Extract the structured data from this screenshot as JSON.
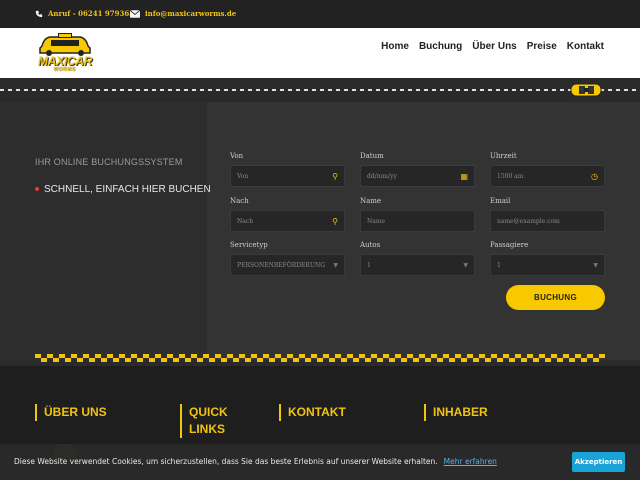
{
  "topbar": {
    "phone": "Anruf - 06241 9793636",
    "email": "info@maxicarworms.de"
  },
  "logo": {
    "name": "MAXICAR",
    "sub": "WORMS"
  },
  "nav": {
    "items": [
      {
        "label": "Home"
      },
      {
        "label": "Buchung"
      },
      {
        "label": "Über Uns"
      },
      {
        "label": "Preise"
      },
      {
        "label": "Kontakt"
      }
    ]
  },
  "booking": {
    "title": "IHR ONLINE BUCHUNGSSYSTEM",
    "subtitle": "SCHNELL, EINFACH HIER BUCHEN",
    "fields": {
      "von": {
        "label": "Von",
        "placeholder": "Von"
      },
      "datum": {
        "label": "Datum",
        "placeholder": "dd/mm/yy"
      },
      "uhrzeit": {
        "label": "Uhrzeit",
        "value": "1500 am"
      },
      "nach": {
        "label": "Nach",
        "placeholder": "Nach"
      },
      "name": {
        "label": "Name",
        "placeholder": "Name"
      },
      "email": {
        "label": "Email",
        "placeholder": "name@example.com"
      },
      "servicetyp": {
        "label": "Servicetyp",
        "value": "PERSONENBEFÖRDERUNG"
      },
      "autos": {
        "label": "Autos",
        "value": "1"
      },
      "passagiere": {
        "label": "Passagiere",
        "value": "1"
      }
    },
    "submit_label": "BUCHUNG"
  },
  "footer": {
    "col1": {
      "line1": "ÜBER UNS"
    },
    "col2": {
      "line1": "QUICK",
      "line2": "LINKS"
    },
    "col3": {
      "line1": "KONTAKT"
    },
    "col4": {
      "line1": "INHABER"
    }
  },
  "cookie": {
    "message": "Diese Website verwendet Cookies, um sicherzustellen, dass Sie das beste Erlebnis auf unserer Website erhalten.",
    "more_label": "Mehr erfahren",
    "accept_label": "Akzeptieren"
  },
  "colors": {
    "accent": "#f9c900",
    "dark": "#2d2d2d",
    "cookie_button": "#1aa3d6"
  }
}
